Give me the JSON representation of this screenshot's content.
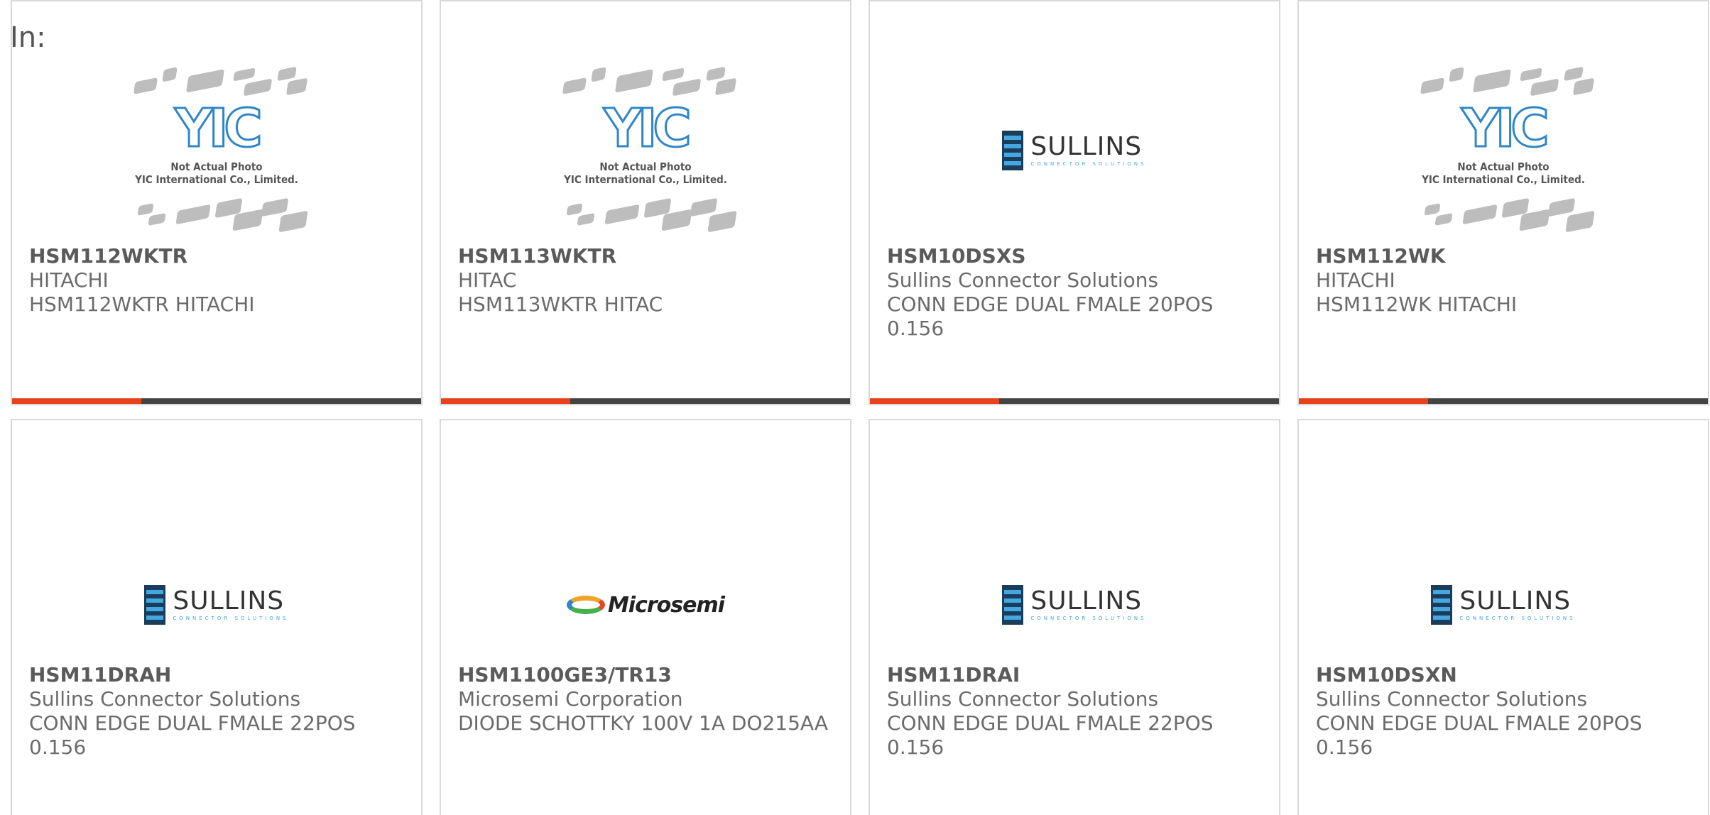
{
  "header": {
    "label": "In:"
  },
  "products": [
    {
      "part_number": "HSM112WKTR",
      "manufacturer": "HITACHI",
      "description": "HSM112WKTR HITACHI",
      "image": "yic-not-actual-photo"
    },
    {
      "part_number": "HSM113WKTR",
      "manufacturer": "HITAC",
      "description": "HSM113WKTR HITAC",
      "image": "yic-not-actual-photo"
    },
    {
      "part_number": "HSM10DSXS",
      "manufacturer": "Sullins Connector Solutions",
      "description": "CONN EDGE DUAL FMALE 20POS 0.156",
      "image": "sullins-logo"
    },
    {
      "part_number": "HSM112WK",
      "manufacturer": "HITACHI",
      "description": "HSM112WK HITACHI",
      "image": "yic-not-actual-photo"
    },
    {
      "part_number": "HSM11DRAH",
      "manufacturer": "Sullins Connector Solutions",
      "description": "CONN EDGE DUAL FMALE 22POS 0.156",
      "image": "sullins-logo"
    },
    {
      "part_number": "HSM1100GE3/TR13",
      "manufacturer": "Microsemi Corporation",
      "description": "DIODE SCHOTTKY 100V 1A DO215AA",
      "image": "microsemi-logo"
    },
    {
      "part_number": "HSM11DRAI",
      "manufacturer": "Sullins Connector Solutions",
      "description": "CONN EDGE DUAL FMALE 22POS 0.156",
      "image": "sullins-logo"
    },
    {
      "part_number": "HSM10DSXN",
      "manufacturer": "Sullins Connector Solutions",
      "description": "CONN EDGE DUAL FMALE 20POS 0.156",
      "image": "sullins-logo"
    }
  ],
  "logos": {
    "yic": {
      "mark": "YIC",
      "line1": "Not Actual Photo",
      "line2": "YIC International Co., Limited."
    },
    "sullins": {
      "name": "SULLINS",
      "tagline": "CONNECTOR SOLUTIONS"
    },
    "microsemi": {
      "name": "Microsemi"
    }
  },
  "colors": {
    "accent": "#e8421b",
    "bar": "#444444",
    "border": "#d9d9d9"
  }
}
